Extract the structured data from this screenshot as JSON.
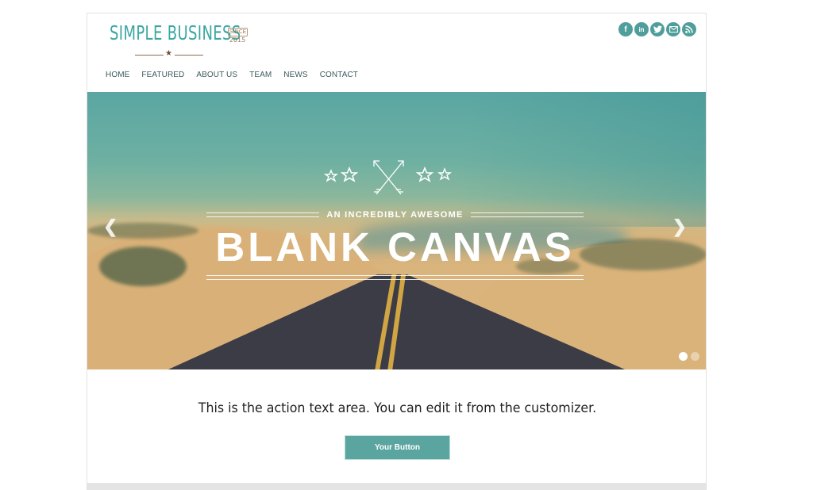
{
  "site": {
    "logo_text": "SIMPLE BUSINESS",
    "logo_badge_top": "SINCE",
    "logo_badge_year": "2015"
  },
  "social": [
    {
      "icon": "facebook-icon",
      "glyph": "f"
    },
    {
      "icon": "linkedin-icon",
      "glyph": "in"
    },
    {
      "icon": "twitter-icon",
      "glyph": "t"
    },
    {
      "icon": "email-icon",
      "glyph": "✉"
    },
    {
      "icon": "rss-icon",
      "glyph": ")"
    }
  ],
  "nav": {
    "items": [
      "HOME",
      "FEATURED",
      "ABOUT US",
      "TEAM",
      "NEWS",
      "CONTACT"
    ]
  },
  "hero": {
    "subtitle": "AN INCREDIBLY AWESOME",
    "title": "BLANK CANVAS",
    "prev_glyph": "❮",
    "next_glyph": "❯",
    "slides_count": 2,
    "active_slide": 1
  },
  "action": {
    "text": "This is the action text area. You can edit it from the customizer.",
    "button_label": "Your Button"
  },
  "colors": {
    "brand_teal": "#3aa6a2",
    "social_bg": "#4f9e9b",
    "button_bg": "#5ba5a0",
    "nav_text": "#3d5a5c"
  }
}
